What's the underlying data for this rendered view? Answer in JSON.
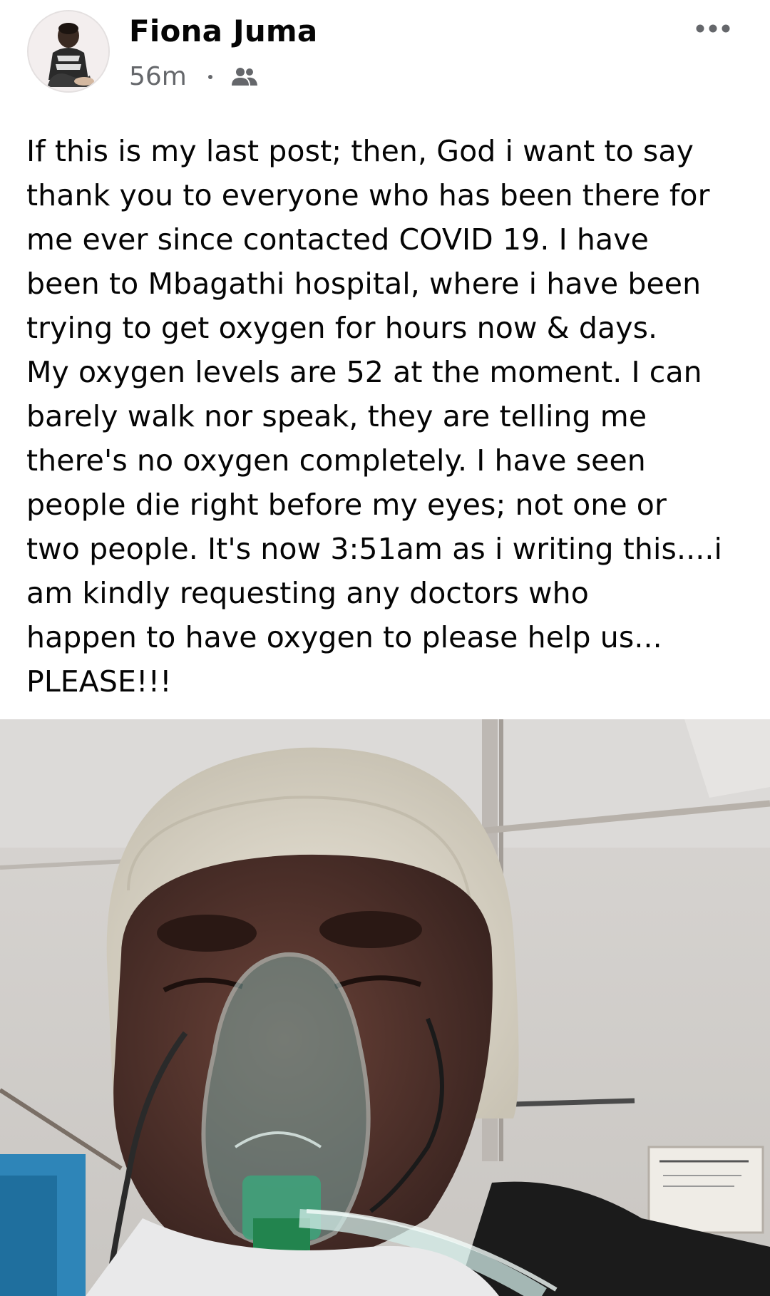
{
  "post": {
    "author": "Fiona Juma",
    "timestamp": "56m",
    "audience_icon": "friends-icon",
    "more_icon": "more-options-icon",
    "text": "If this is my last post; then, God i want to say\nthank you to everyone who has been there for\nme ever since contacted COVID 19. I have\nbeen to Mbagathi hospital, where i have been\ntrying to get oxygen for hours now & days.\nMy oxygen levels are 52 at the moment. I can\nbarely walk nor speak, they are telling me\nthere's no oxygen completely. I have seen\npeople die right before my eyes; not one or\ntwo people. It's now 3:51am as i writing this....i\nam kindly requesting any doctors who\nhappen to have oxygen to please help us...\nPLEASE!!!"
  },
  "colors": {
    "text": "#050505",
    "secondary_text": "#65676b",
    "background": "#ffffff"
  }
}
